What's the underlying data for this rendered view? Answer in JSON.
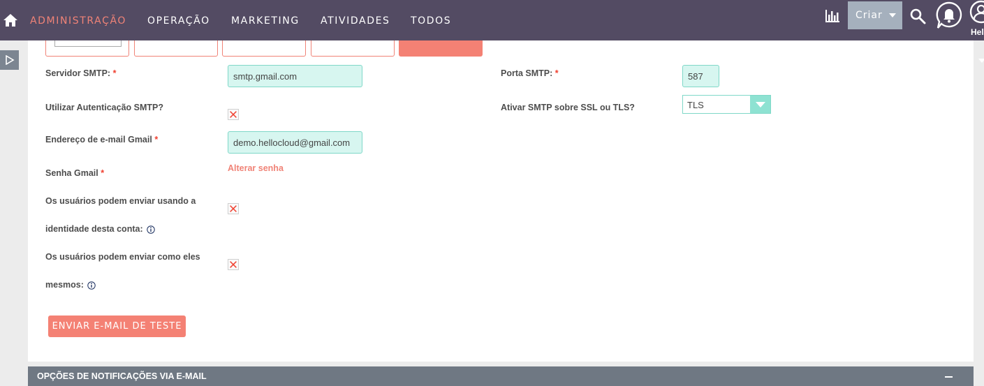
{
  "nav": {
    "items": [
      {
        "label": "ADMINISTRAÇÃO",
        "active": true
      },
      {
        "label": "OPERAÇÃO",
        "active": false
      },
      {
        "label": "MARKETING",
        "active": false
      },
      {
        "label": "ATIVIDADES",
        "active": false
      },
      {
        "label": "TODOS",
        "active": false
      }
    ],
    "create_label": "Criar",
    "user_label": "Hel"
  },
  "form": {
    "smtp_server": {
      "label": "Servidor SMTP:",
      "required": "*",
      "value": "smtp.gmail.com"
    },
    "smtp_port": {
      "label": "Porta SMTP:",
      "required": "*",
      "value": "587"
    },
    "smtp_auth": {
      "label": "Utilizar Autenticação SMTP?",
      "checked": true
    },
    "smtp_ssl": {
      "label": "Ativar SMTP sobre SSL ou TLS?",
      "selected": "TLS"
    },
    "gmail_address": {
      "label": "Endereço de e-mail Gmail",
      "required": "*",
      "value": "demo.hellocloud@gmail.com"
    },
    "gmail_password": {
      "label": "Senha Gmail",
      "required": "*",
      "link": "Alterar senha"
    },
    "send_as_identity": {
      "label_line1": "Os usuários podem enviar usando a",
      "label_line2": "identidade desta conta:",
      "checked": true
    },
    "send_as_self": {
      "label_line1": "Os usuários podem enviar como eles",
      "label_line2": "mesmos:",
      "checked": true
    },
    "test_button": "ENVIAR E-MAIL DE TESTE"
  },
  "section": {
    "title": "OPÇÕES DE NOTIFICAÇÕES VIA E-MAIL"
  },
  "colors": {
    "nav_bg": "#534b63",
    "accent": "#f08377",
    "input_bg": "#d7f6f0"
  }
}
